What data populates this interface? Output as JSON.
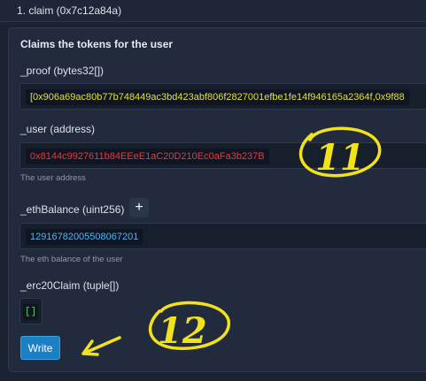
{
  "function_header": {
    "title": "1. claim (0x7c12a84a)"
  },
  "function_description": "Claims the tokens for the user",
  "params": {
    "proof": {
      "label": "_proof (bytes32[])",
      "value": "[0x906a69ac80b77b748449ac3bd423abf806f2827001efbe1fe14f946165a2364f,0x9f88"
    },
    "user": {
      "label": "_user (address)",
      "value": "0x8144c9927611b84EEeE1aC20D210Ec0aFa3b237B",
      "hint": "The user address"
    },
    "eth_balance": {
      "label": "_ethBalance (uint256)",
      "add_label": "+",
      "value": "12916782005508067201",
      "hint": "The eth balance of the user"
    },
    "erc20_claim": {
      "label": "_erc20Claim (tuple[])",
      "value": "[]"
    }
  },
  "write_button": {
    "label": "Write"
  },
  "annotations": {
    "mark_11": "11",
    "mark_12": "12"
  },
  "colors": {
    "background": "#1b2333",
    "panel": "#222b3d",
    "accent_button": "#1b7fc3",
    "annotation": "#f2e21c",
    "proof_text": "#e2e03c",
    "address_text": "#e23d3d",
    "number_text": "#57b3ef",
    "array_text": "#5fd35f"
  }
}
